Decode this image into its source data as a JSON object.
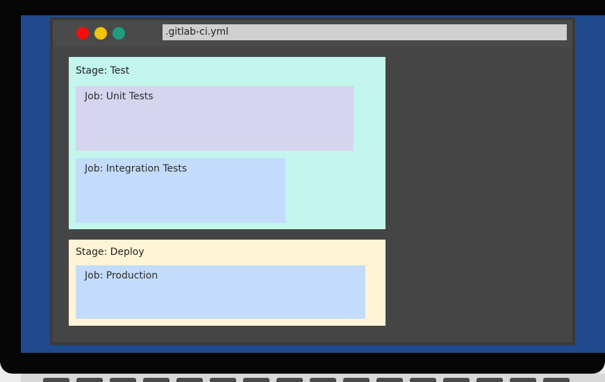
{
  "window": {
    "tab_title": ".gitlab-ci.yml"
  },
  "stages": [
    {
      "label": "Stage: Test",
      "color": "#c2f5ec",
      "jobs": [
        {
          "label": "Job: Unit Tests",
          "color": "#d6d5f0"
        },
        {
          "label": "Job: Integration Tests",
          "color": "#c4dcfb"
        }
      ]
    },
    {
      "label": "Stage: Deploy",
      "color": "#fff5d6",
      "jobs": [
        {
          "label": "Job: Production",
          "color": "#c4dcfb"
        }
      ]
    }
  ],
  "colors": {
    "screen": "#1f4a8e",
    "window": "#454545",
    "close_dot": "#f50d0d",
    "minimize_dot": "#f5c20f",
    "maximize_dot": "#239b7d"
  }
}
